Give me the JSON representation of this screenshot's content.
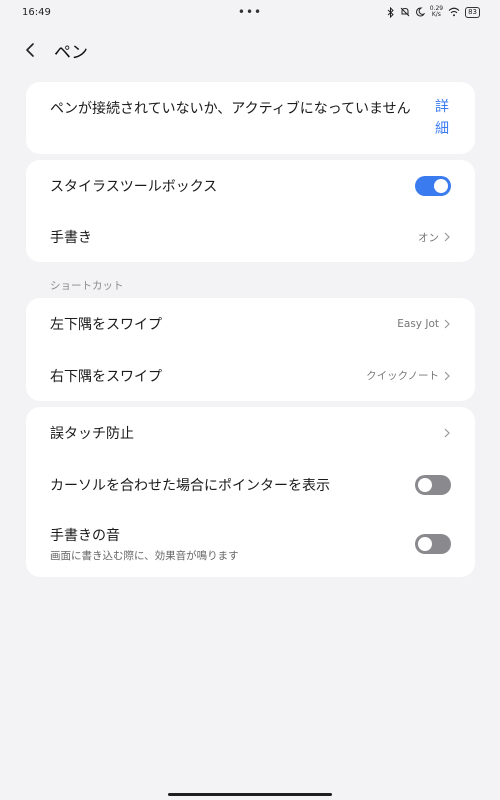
{
  "status_bar": {
    "time": "16:49",
    "dots": "•••",
    "speed_top": "0.29",
    "speed_bottom": "K/s",
    "battery": "83"
  },
  "header": {
    "title": "ペン"
  },
  "warning_card": {
    "message": "ペンが接続されていないか、アクティブになっていません",
    "detail_link": "詳細"
  },
  "pen_card": {
    "stylus_toolbox": {
      "label": "スタイラスツールボックス",
      "toggle": "on"
    },
    "handwriting": {
      "label": "手書き",
      "value": "オン"
    }
  },
  "shortcut_section": {
    "label": "ショートカット",
    "swipe_bottom_left": {
      "label": "左下隅をスワイプ",
      "value": "Easy Jot"
    },
    "swipe_bottom_right": {
      "label": "右下隅をスワイプ",
      "value": "クイックノート"
    }
  },
  "misc_card": {
    "touch_prevention": {
      "label": "誤タッチ防止"
    },
    "pointer_on_hover": {
      "label": "カーソルを合わせた場合にポインターを表示",
      "toggle": "off"
    },
    "handwriting_sound": {
      "label": "手書きの音",
      "sublabel": "画面に書き込む際に、効果音が鳴ります",
      "toggle": "off"
    }
  },
  "colors": {
    "accent": "#3a7bf0",
    "background": "#f3f3f5",
    "card": "#ffffff",
    "toggle_off": "#8a8a8e"
  },
  "icons": [
    "bluetooth-icon",
    "mute-icon",
    "moon-icon",
    "wifi-icon",
    "battery-icon",
    "back-chevron-icon",
    "chevron-right-icon"
  ]
}
